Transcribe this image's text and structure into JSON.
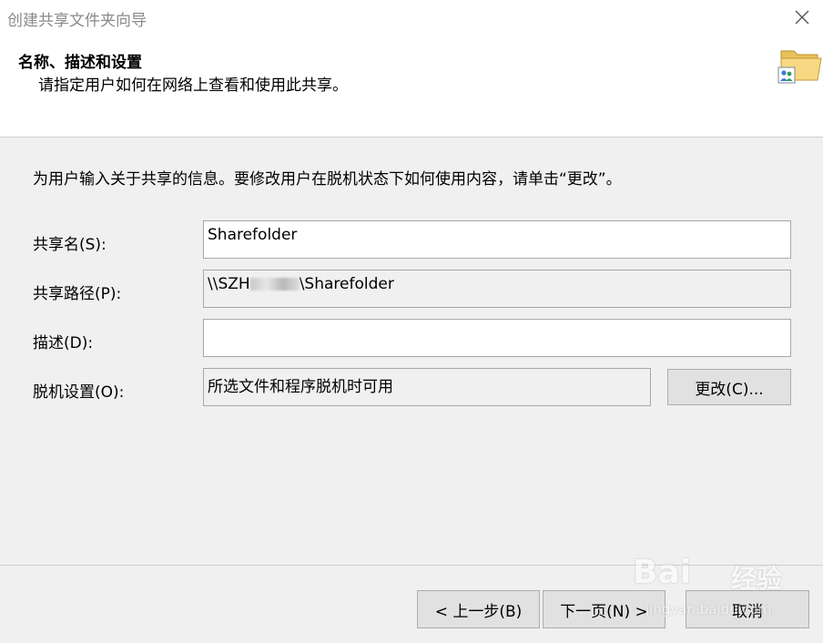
{
  "window": {
    "title": "创建共享文件夹向导"
  },
  "header": {
    "title": "名称、描述和设置",
    "subtitle": "请指定用户如何在网络上查看和使用此共享。",
    "icon": "shared-folder-icon"
  },
  "intro": "为用户输入关于共享的信息。要修改用户在脱机状态下如何使用内容，请单击“更改”。",
  "fields": {
    "share_name": {
      "label": "共享名(S):",
      "value": "Sharefolder"
    },
    "share_path": {
      "label": "共享路径(P):",
      "value_prefix": "\\\\SZH",
      "value_suffix": "\\Sharefolder"
    },
    "description": {
      "label": "描述(D):",
      "value": ""
    },
    "offline": {
      "label": "脱机设置(O):",
      "value": "所选文件和程序脱机时可用",
      "change_label": "更改(C)..."
    }
  },
  "footer": {
    "back_label": "< 上一步(B)",
    "next_label": "下一页(N) >",
    "cancel_label": "取消"
  },
  "watermark": {
    "brand": "Bai",
    "brand2": "经验",
    "url": "jingyan.baidu.com"
  }
}
